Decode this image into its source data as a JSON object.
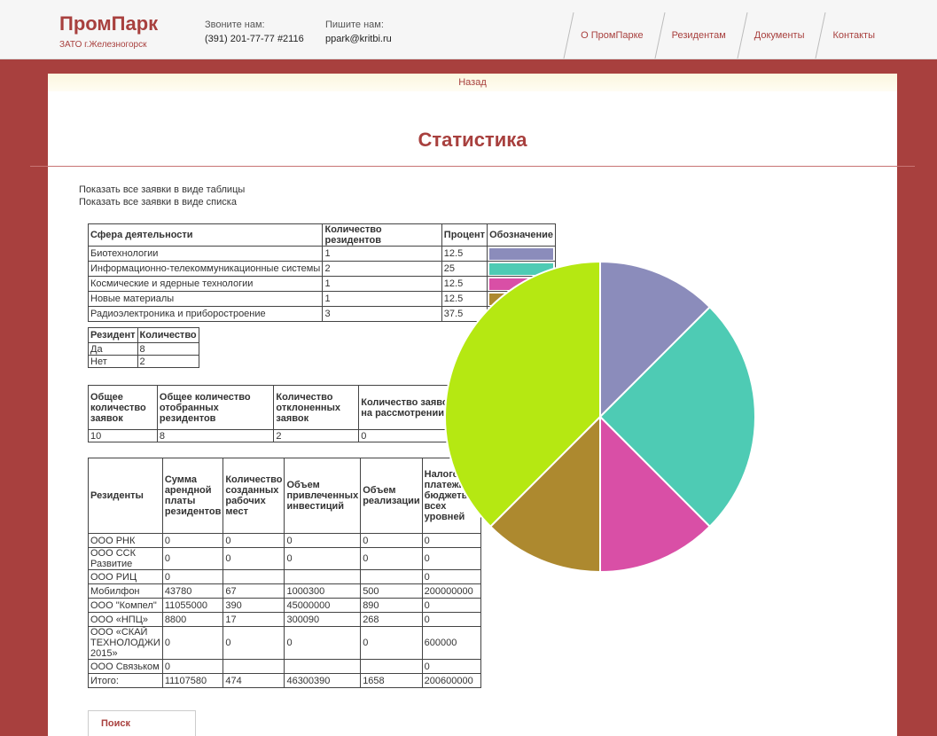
{
  "header": {
    "logo": "ПромПарк",
    "logo_sub": "ЗАТО г.Железногорск",
    "phone_label": "Звоните нам:",
    "phone": "(391) 201-77-77 #2116",
    "email_label": "Пишите нам:",
    "email": "ppark@kritbi.ru",
    "nav": [
      "О ПромПарке",
      "Резидентам",
      "Документы",
      "Контакты"
    ]
  },
  "back_label": "Назад",
  "page_title": "Статистика",
  "links": [
    "Показать все заявки в виде таблицы",
    "Показать все заявки в виде списка"
  ],
  "sphere_table": {
    "headers": [
      "Сфера деятельности",
      "Количество резидентов",
      "Процент",
      "Обозначение"
    ],
    "rows": [
      {
        "name": "Биотехнологии",
        "count": "1",
        "percent": "12.5",
        "color": "#8b8cbb"
      },
      {
        "name": "Информационно-телекоммуникационные системы",
        "count": "2",
        "percent": "25",
        "color": "#4ecbb4"
      },
      {
        "name": "Космические и ядерные технологии",
        "count": "1",
        "percent": "12.5",
        "color": "#d94fa6"
      },
      {
        "name": "Новые материалы",
        "count": "1",
        "percent": "12.5",
        "color": "#ad892f"
      },
      {
        "name": "Радиоэлектроника и приборостроение",
        "count": "3",
        "percent": "37.5",
        "color": "#b5e812"
      }
    ]
  },
  "resident_table": {
    "headers": [
      "Резидент",
      "Количество"
    ],
    "rows": [
      [
        "Да",
        "8"
      ],
      [
        "Нет",
        "2"
      ]
    ]
  },
  "applications_table": {
    "headers": [
      "Общее количество заявок",
      "Общее количество отобранных резидентов",
      "Количество отклоненных заявок",
      "Количество заявок на рассмотрении"
    ],
    "row": [
      "10",
      "8",
      "2",
      "0"
    ]
  },
  "finance_table": {
    "headers": [
      "Резиденты",
      "Сумма арендной платы резидентов",
      "Количество созданных рабочих мест",
      "Объем привлеченных инвестиций",
      "Объем реализации",
      "Налоговые платежи в бюджеты всех уровней"
    ],
    "rows": [
      [
        "ООО РНК",
        "0",
        "0",
        "0",
        "0",
        "0"
      ],
      [
        "ООО ССК Развитие",
        "0",
        "0",
        "0",
        "0",
        "0"
      ],
      [
        "ООО РИЦ",
        "0",
        "",
        "",
        "",
        "0"
      ],
      [
        "Мобилфон",
        "43780",
        "67",
        "1000300",
        "500",
        "200000000"
      ],
      [
        "ООО \"Компел\"",
        "11055000",
        "390",
        "45000000",
        "890",
        "0"
      ],
      [
        "ООО «НПЦ»",
        "8800",
        "17",
        "300090",
        "268",
        "0"
      ],
      [
        "ООО «СКАЙ ТЕХНОЛОДЖИ 2015»",
        "0",
        "0",
        "0",
        "0",
        "600000"
      ],
      [
        "ООО Связьком",
        "0",
        "",
        "",
        "",
        "0"
      ],
      [
        "Итого:",
        "11107580",
        "474",
        "46300390",
        "1658",
        "200600000"
      ]
    ]
  },
  "search_label": "Поиск",
  "chart_data": {
    "type": "pie",
    "categories": [
      "Биотехнологии",
      "Информационно-телекоммуникационные системы",
      "Космические и ядерные технологии",
      "Новые материалы",
      "Радиоэлектроника и приборостроение"
    ],
    "values": [
      1,
      2,
      1,
      1,
      3
    ],
    "colors": [
      "#8b8cbb",
      "#4ecbb4",
      "#d94fa6",
      "#ad892f",
      "#b5e812"
    ]
  }
}
